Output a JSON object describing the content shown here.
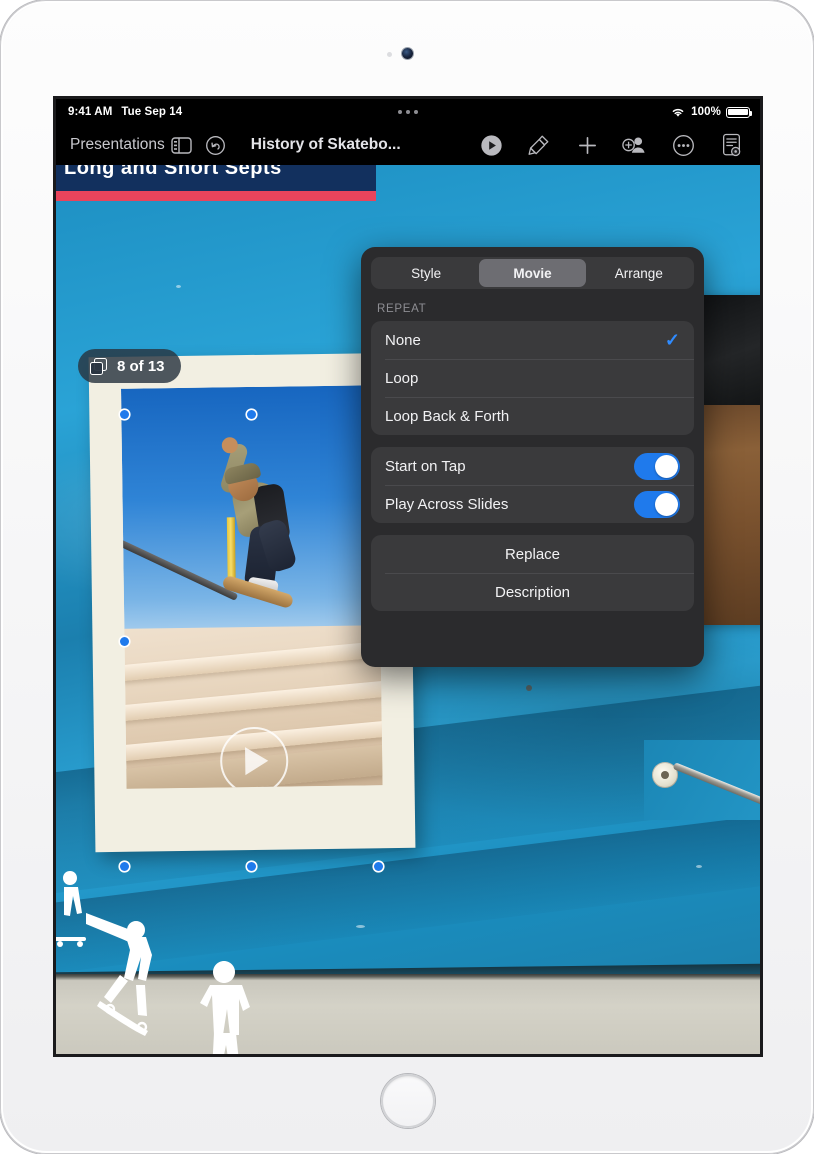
{
  "status_bar": {
    "time": "9:41 AM",
    "date": "Tue Sep 14",
    "battery_percent": "100%",
    "wifi_icon": "wifi-icon",
    "battery_icon": "battery-icon",
    "multitask_icon": "multitask-dots-icon"
  },
  "toolbar": {
    "back_label": "Presentations",
    "navigator_icon": "slide-navigator-icon",
    "undo_icon": "undo-icon",
    "document_title": "History of Skatebo...",
    "play_icon": "play-icon",
    "format_icon": "format-brush-icon",
    "insert_icon": "add-plus-icon",
    "collaborate_icon": "add-collaborator-icon",
    "more_icon": "more-ellipsis-icon",
    "document_options_icon": "document-options-icon"
  },
  "slide": {
    "counter_badge": "8 of 13",
    "counter_icon": "slides-stack-icon",
    "title_text": "Long and Short Septs",
    "media_play_icon": "play-overlay-icon",
    "selection_handle": "selection-handle"
  },
  "popover": {
    "tabs": [
      {
        "label": "Style",
        "active": false
      },
      {
        "label": "Movie",
        "active": true
      },
      {
        "label": "Arrange",
        "active": false
      }
    ],
    "repeat_section_label": "REPEAT",
    "repeat_options": [
      {
        "label": "None",
        "selected": true
      },
      {
        "label": "Loop",
        "selected": false
      },
      {
        "label": "Loop Back & Forth",
        "selected": false
      }
    ],
    "switches": [
      {
        "label": "Start on Tap",
        "on": true
      },
      {
        "label": "Play Across Slides",
        "on": true
      }
    ],
    "actions": [
      {
        "label": "Replace"
      },
      {
        "label": "Description"
      }
    ],
    "checkmark_glyph": "✓",
    "accent_color": "#1f7aec",
    "panel_color": "#2b2b2d",
    "group_color": "#3a3a3c"
  }
}
